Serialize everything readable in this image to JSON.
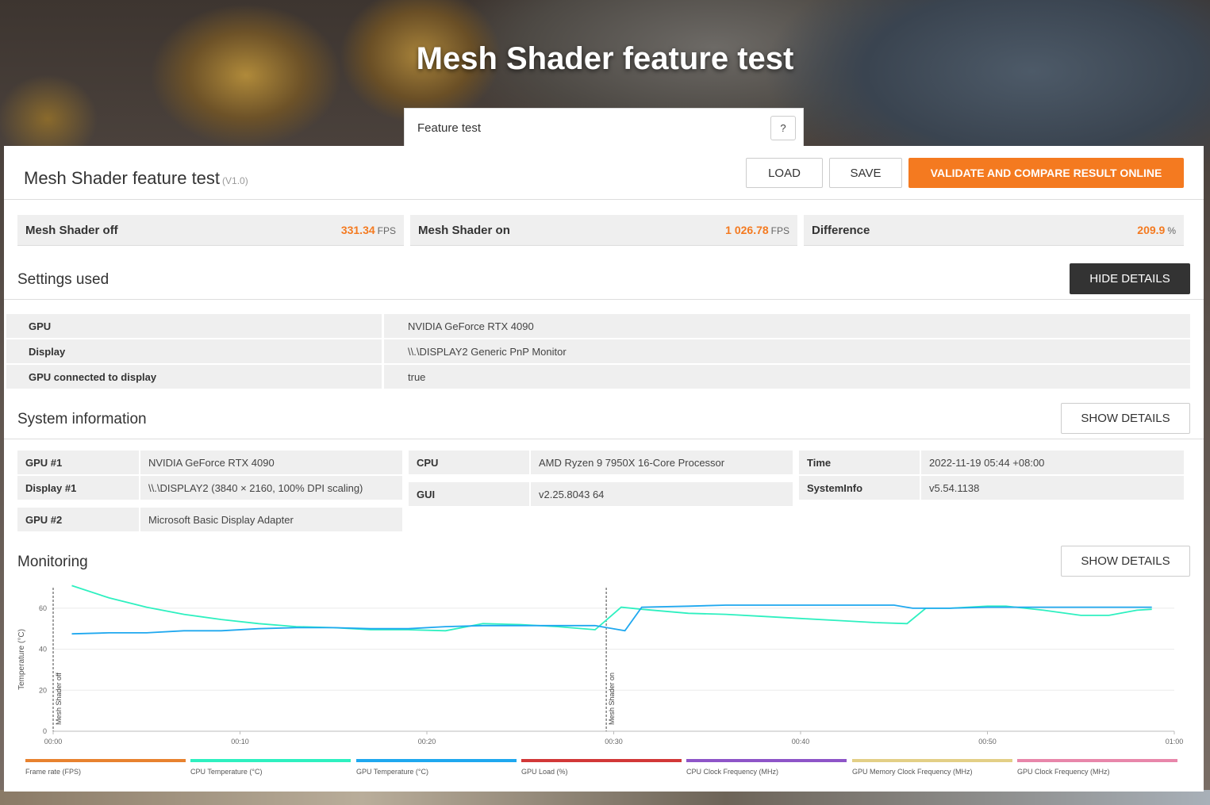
{
  "hero": {
    "title": "Mesh Shader feature test"
  },
  "tab": {
    "label": "Feature test",
    "help_label": "?"
  },
  "panel": {
    "title": "Mesh Shader feature test",
    "version": "(V1.0)",
    "load_label": "LOAD",
    "save_label": "SAVE",
    "validate_label": "VALIDATE AND COMPARE RESULT ONLINE"
  },
  "results": [
    {
      "label": "Mesh Shader off",
      "value": "331.34",
      "unit": "FPS"
    },
    {
      "label": "Mesh Shader on",
      "value": "1 026.78",
      "unit": "FPS"
    },
    {
      "label": "Difference",
      "value": "209.9",
      "unit": "%"
    }
  ],
  "settings": {
    "title": "Settings used",
    "toggle_label": "HIDE DETAILS",
    "rows": [
      {
        "key": "GPU",
        "value": "NVIDIA GeForce RTX 4090"
      },
      {
        "key": "Display",
        "value": "\\\\.\\DISPLAY2 Generic PnP Monitor"
      },
      {
        "key": "GPU connected to display",
        "value": "true"
      }
    ]
  },
  "system": {
    "title": "System information",
    "toggle_label": "SHOW DETAILS",
    "col1": [
      {
        "key": "GPU #1",
        "value": "NVIDIA GeForce RTX 4090"
      },
      {
        "key": "Display #1",
        "value": "\\\\.\\DISPLAY2 (3840 × 2160, 100% DPI scaling)"
      },
      {
        "key": "GPU #2",
        "value": "Microsoft Basic Display Adapter"
      }
    ],
    "col2": [
      {
        "key": "CPU",
        "value": "AMD Ryzen 9 7950X 16-Core Processor"
      },
      {
        "key": "GUI",
        "value": "v2.25.8043 64"
      }
    ],
    "col3": [
      {
        "key": "Time",
        "value": "2022-11-19 05:44 +08:00"
      },
      {
        "key": "SystemInfo",
        "value": "v5.54.1138"
      }
    ]
  },
  "monitoring": {
    "title": "Monitoring",
    "toggle_label": "SHOW DETAILS",
    "legend": [
      {
        "label": "Frame rate (FPS)",
        "color": "#e8822f"
      },
      {
        "label": "CPU Temperature (°C)",
        "color": "#2ef0c0"
      },
      {
        "label": "GPU Temperature (°C)",
        "color": "#1fa8ef"
      },
      {
        "label": "GPU Load (%)",
        "color": "#d23838"
      },
      {
        "label": "CPU Clock Frequency (MHz)",
        "color": "#8e55c8"
      },
      {
        "label": "GPU Memory Clock Frequency (MHz)",
        "color": "#e3cf86"
      },
      {
        "label": "GPU Clock Frequency (MHz)",
        "color": "#e886aa"
      }
    ]
  },
  "chart_data": {
    "type": "line",
    "ylabel": "Temperature (°C)",
    "ylim": [
      0,
      70
    ],
    "xlim": [
      0,
      60
    ],
    "yticks": [
      0,
      20,
      40,
      60
    ],
    "xticks": [
      "00:00",
      "00:10",
      "00:20",
      "00:30",
      "00:40",
      "00:50",
      "01:00"
    ],
    "markers": [
      {
        "label": "Mesh Shader off",
        "x": 0
      },
      {
        "label": "Mesh Shader on",
        "x": 29.6
      }
    ],
    "series": [
      {
        "name": "CPU Temperature (°C)",
        "color": "#2ef0c0",
        "x": [
          1,
          3,
          5,
          7,
          9,
          11,
          13,
          15,
          17,
          19,
          21,
          23,
          25,
          27,
          29,
          30.4,
          31.5,
          34,
          36,
          38,
          40,
          42,
          44,
          45.7,
          46.7,
          48,
          50,
          51,
          53,
          55,
          56.5,
          58,
          58.8
        ],
        "y": [
          71,
          65,
          60.5,
          57,
          54.5,
          52.5,
          51,
          50.5,
          49.5,
          49.5,
          49,
          52.5,
          52,
          51,
          49.5,
          60.5,
          59.5,
          57.5,
          57,
          56,
          55,
          54,
          53,
          52.5,
          60,
          60,
          61,
          61,
          59,
          56.5,
          56.5,
          59,
          59.5
        ]
      },
      {
        "name": "GPU Temperature (°C)",
        "color": "#1fa8ef",
        "x": [
          1,
          3,
          5,
          7,
          9,
          11,
          13,
          15,
          17,
          19,
          21,
          23,
          25,
          27,
          29,
          30.6,
          31.5,
          34,
          36,
          38,
          40,
          42,
          44,
          45,
          46,
          48,
          50,
          52,
          54,
          56,
          58,
          58.8
        ],
        "y": [
          47.5,
          48,
          48,
          49,
          49,
          50,
          50.5,
          50.5,
          50,
          50,
          51,
          51.5,
          51.5,
          51.5,
          51.5,
          49,
          60.5,
          61,
          61.5,
          61.5,
          61.5,
          61.5,
          61.5,
          61.5,
          60,
          60,
          60.5,
          60.5,
          60.5,
          60.5,
          60.5,
          60.5
        ]
      }
    ]
  }
}
